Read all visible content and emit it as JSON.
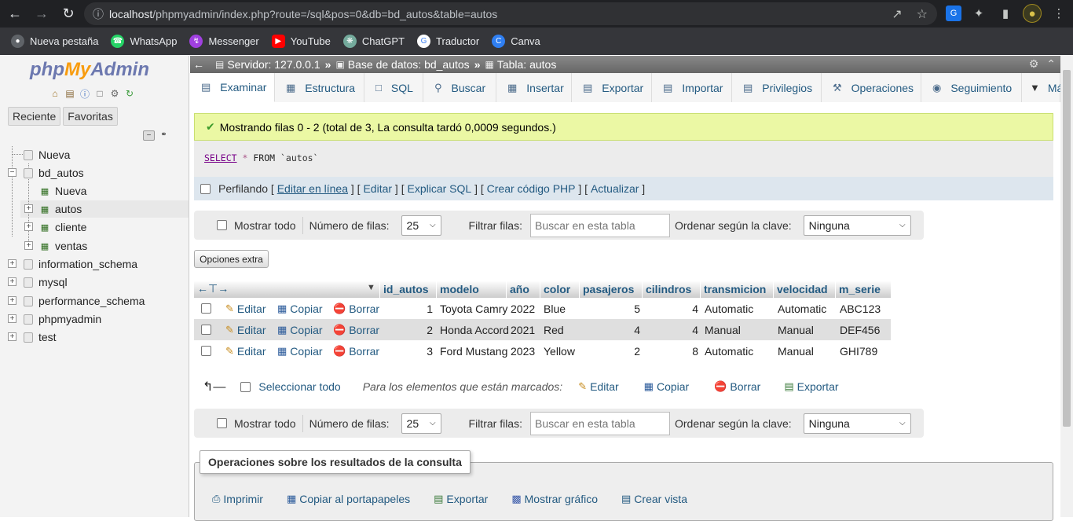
{
  "browser": {
    "url_host": "localhost",
    "url_rest": "/phpmyadmin/index.php?route=/sql&pos=0&db=bd_autos&table=autos",
    "bookmarks": [
      "Nueva pestaña",
      "WhatsApp",
      "Messenger",
      "YouTube",
      "ChatGPT",
      "Traductor",
      "Canva"
    ]
  },
  "sidebar": {
    "logo_php": "php",
    "logo_my": "My",
    "logo_admin": "Admin",
    "tab_recent": "Reciente",
    "tab_favorites": "Favoritas",
    "tree": {
      "new": "Nueva",
      "db_bd_autos": "bd_autos",
      "db_new": "Nueva",
      "tbl_autos": "autos",
      "tbl_cliente": "cliente",
      "tbl_ventas": "ventas",
      "db_information_schema": "information_schema",
      "db_mysql": "mysql",
      "db_performance_schema": "performance_schema",
      "db_phpmyadmin": "phpmyadmin",
      "db_test": "test"
    }
  },
  "breadcrumb": {
    "server": "Servidor: 127.0.0.1",
    "database": "Base de datos: bd_autos",
    "table": "Tabla: autos"
  },
  "tabs": [
    "Examinar",
    "Estructura",
    "SQL",
    "Buscar",
    "Insertar",
    "Exportar",
    "Importar",
    "Privilegios",
    "Operaciones",
    "Seguimiento",
    "Más"
  ],
  "message": "Mostrando filas 0 - 2 (total de 3, La consulta tardó 0,0009 segundos.)",
  "sql": {
    "select": "SELECT",
    "star": "*",
    "from": "FROM",
    "table": "`autos`"
  },
  "profiling": {
    "label": "Perfilando",
    "edit_inline": "Editar en línea",
    "edit": "Editar",
    "explain": "Explicar SQL",
    "php_code": "Crear código PHP",
    "refresh": "Actualizar"
  },
  "navbar": {
    "show_all": "Mostrar todo",
    "rows_label": "Número de filas:",
    "rows_value": "25",
    "filter_label": "Filtrar filas:",
    "filter_placeholder": "Buscar en esta tabla",
    "sort_label": "Ordenar según la clave:",
    "sort_value": "Ninguna"
  },
  "extra_options": "Opciones extra",
  "table": {
    "columns": [
      "id_autos",
      "modelo",
      "año",
      "color",
      "pasajeros",
      "cilindros",
      "transmicion",
      "velocidad",
      "m_serie"
    ],
    "actions": {
      "edit": "Editar",
      "copy": "Copiar",
      "delete": "Borrar"
    },
    "rows": [
      [
        "1",
        "Toyota Camry",
        "2022",
        "Blue",
        "5",
        "4",
        "Automatic",
        "Automatic",
        "ABC123"
      ],
      [
        "2",
        "Honda Accord",
        "2021",
        "Red",
        "4",
        "4",
        "Manual",
        "Manual",
        "DEF456"
      ],
      [
        "3",
        "Ford Mustang",
        "2023",
        "Yellow",
        "2",
        "8",
        "Automatic",
        "Manual",
        "GHI789"
      ]
    ]
  },
  "bulk": {
    "select_all": "Seleccionar todo",
    "for_marked": "Para los elementos que están marcados:",
    "edit": "Editar",
    "copy": "Copiar",
    "delete": "Borrar",
    "export": "Exportar"
  },
  "query_ops": {
    "legend": "Operaciones sobre los resultados de la consulta",
    "print": "Imprimir",
    "clipboard": "Copiar al portapapeles",
    "export": "Exportar",
    "chart": "Mostrar gráfico",
    "view": "Crear vista"
  }
}
